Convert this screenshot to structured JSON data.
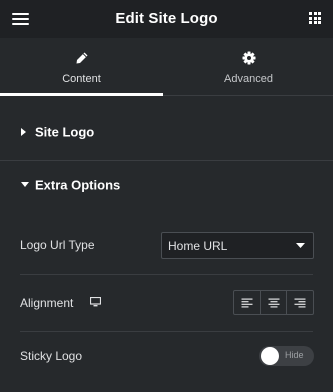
{
  "header": {
    "title": "Edit Site Logo",
    "menu_icon": "hamburger-menu-icon",
    "apps_icon": "grid-apps-icon"
  },
  "tabs": [
    {
      "label": "Content",
      "icon": "pencil-icon",
      "active": true
    },
    {
      "label": "Advanced",
      "icon": "gear-icon",
      "active": false
    }
  ],
  "sections": {
    "site_logo": {
      "title": "Site Logo",
      "expanded": false
    },
    "extra_options": {
      "title": "Extra Options",
      "expanded": true
    }
  },
  "controls": {
    "logo_url_type": {
      "label": "Logo Url Type",
      "value": "Home URL"
    },
    "alignment": {
      "label": "Alignment",
      "device_icon": "desktop-monitor-icon",
      "options": [
        "left",
        "center",
        "right"
      ]
    },
    "sticky_logo": {
      "label": "Sticky Logo",
      "toggle_text": "Hide",
      "on": false
    }
  },
  "colors": {
    "header_bg": "#1f2124",
    "panel_bg": "#26292c",
    "border": "#3a3d41",
    "text": "#e0e1e3"
  }
}
